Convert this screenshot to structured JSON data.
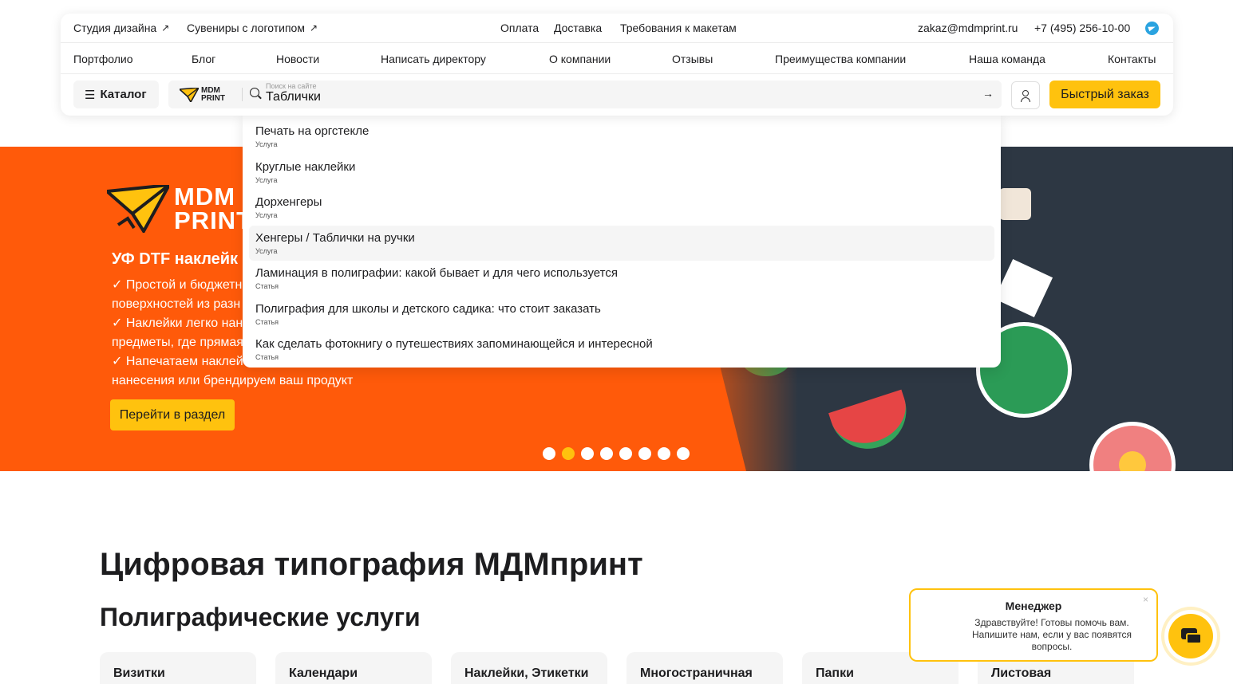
{
  "topbar": {
    "left_links": [
      "Студия дизайна",
      "Сувениры с логотипом"
    ],
    "center_links": [
      "Оплата",
      "Доставка",
      "Требования к макетам"
    ],
    "email": "zakaz@mdmprint.ru",
    "phone": "+7 (495) 256-10-00",
    "arrow_icon": "↗"
  },
  "nav": [
    "Портфолио",
    "Блог",
    "Новости",
    "Написать директору",
    "О компании",
    "Отзывы",
    "Преимущества компании",
    "Наша команда",
    "Контакты"
  ],
  "toolbar": {
    "catalog_label": "Каталог",
    "burger_icon": "☰",
    "logo_line1": "MDM",
    "logo_line2": "PRINT",
    "search_placeholder": "Поиск на сайте",
    "search_value": "Таблички",
    "search_go_icon": "→",
    "quick_order_label": "Быстрый заказ"
  },
  "search_results": [
    {
      "title": "Печать на оргстекле",
      "type": "Услуга"
    },
    {
      "title": "Круглые наклейки",
      "type": "Услуга"
    },
    {
      "title": "Дорхенгеры",
      "type": "Услуга"
    },
    {
      "title": "Хенгеры / Таблички на ручки",
      "type": "Услуга",
      "active": true
    },
    {
      "title": "Ламинация в полиграфии: какой бывает и для чего используется",
      "type": "Статья"
    },
    {
      "title": "Полиграфия для школы и детского садика: что стоит заказать",
      "type": "Статья"
    },
    {
      "title": "Как сделать фотокнигу о путешествиях запоминающейся и интересной",
      "type": "Статья"
    }
  ],
  "hero": {
    "logo_line1": "MDM",
    "logo_line2": "PRINT",
    "title": "УФ DTF наклейк",
    "text_lines": [
      "✓ Простой и бюджетн",
      "поверхностей из разн",
      "✓ Наклейки легко нан",
      "предметы, где прямая",
      "✓ Напечатаем наклей",
      "нанесения или брендируем ваш продукт"
    ],
    "button_label": "Перейти в раздел",
    "slides_total": 8,
    "active_slide": 2,
    "accent": "#ff5a0a",
    "yellow": "#ffc20e"
  },
  "main": {
    "title": "Цифровая типография МДМпринт",
    "subtitle": "Полиграфические услуги",
    "cards": [
      "Визитки",
      "Календари",
      "Наклейки, Этикетки",
      "Многостраничная",
      "Папки",
      "Листовая"
    ]
  },
  "chat": {
    "title": "Менеджер",
    "message": "Здравствуйте! Готовы помочь вам. Напишите нам, если у вас появятся вопросы.",
    "close_icon": "×"
  }
}
